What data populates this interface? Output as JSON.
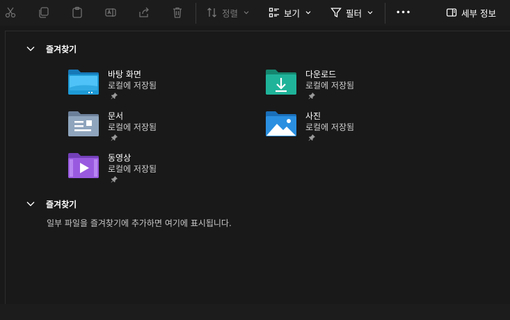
{
  "toolbar": {
    "icons": [
      "cut-icon",
      "copy-icon",
      "paste-icon",
      "rename-icon",
      "share-icon",
      "delete-icon"
    ],
    "sort_label": "정렬",
    "view_label": "보기",
    "filter_label": "필터",
    "more_label": "•••",
    "details_label": "세부 정보"
  },
  "quick_access": {
    "title": "즐겨찾기",
    "items": [
      {
        "name": "바탕 화면",
        "location": "로컬에 저장됨",
        "icon": "desktop-folder-icon"
      },
      {
        "name": "다운로드",
        "location": "로컬에 저장됨",
        "icon": "downloads-folder-icon"
      },
      {
        "name": "문서",
        "location": "로컬에 저장됨",
        "icon": "documents-folder-icon"
      },
      {
        "name": "사진",
        "location": "로컬에 저장됨",
        "icon": "pictures-folder-icon"
      },
      {
        "name": "동영상",
        "location": "로컬에 저장됨",
        "icon": "videos-folder-icon"
      }
    ]
  },
  "favorites": {
    "title": "즐겨찾기",
    "empty_message": "일부 파일을 즐겨찾기에 추가하면 여기에 표시됩니다."
  },
  "colors": {
    "background": "#191919",
    "toolbar": "#1c1c1c",
    "desktop": "#1e9ad6",
    "downloads": "#1fb39a",
    "documents": "#8fa5bd",
    "pictures": "#2a8fe0",
    "videos": "#9a5ae0"
  }
}
